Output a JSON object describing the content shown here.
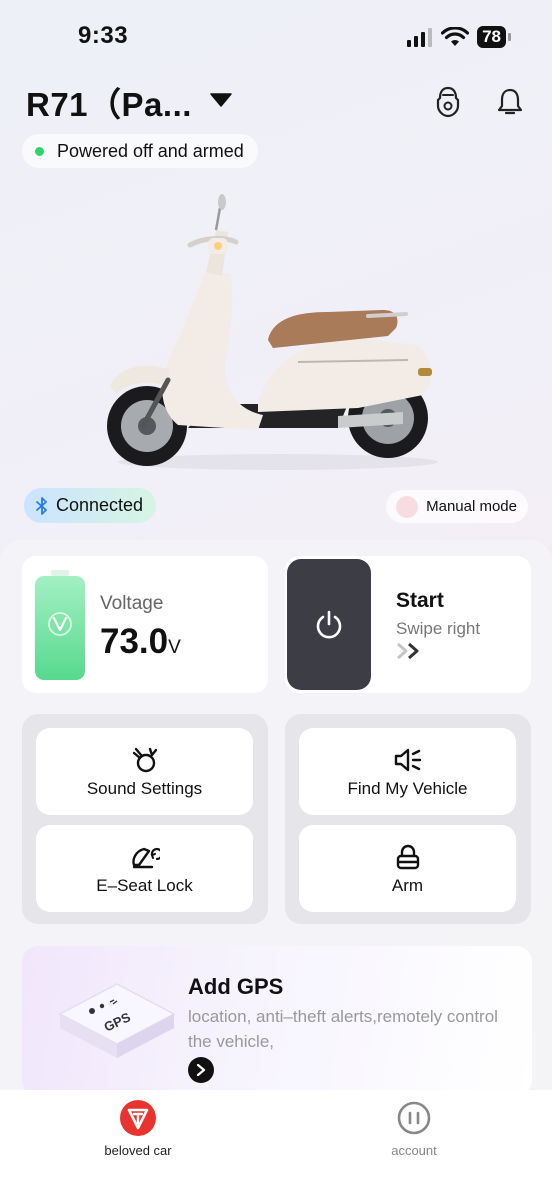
{
  "status_bar": {
    "time": "9:33",
    "battery": "78"
  },
  "header": {
    "vehicle_name": "R71（Pa...",
    "icons": [
      "scooter-outline-icon",
      "bell-icon"
    ]
  },
  "vehicle_status": "Powered off and armed",
  "connection": {
    "label": "Connected",
    "icon": "bluetooth-icon"
  },
  "manual_mode": {
    "label": "Manual mode"
  },
  "voltage": {
    "label": "Voltage",
    "value": "73.0",
    "unit": "V"
  },
  "start": {
    "title": "Start",
    "subtitle": "Swipe right",
    "icon": "power-icon"
  },
  "actions": {
    "sound_settings": {
      "label": "Sound Settings",
      "icon": "sound-icon"
    },
    "find_vehicle": {
      "label": "Find My Vehicle",
      "icon": "speaker-icon"
    },
    "eseat_lock": {
      "label": "E–Seat Lock",
      "icon": "seat-lock-icon"
    },
    "arm": {
      "label": "Arm",
      "icon": "lock-icon"
    }
  },
  "gps_promo": {
    "title": "Add GPS",
    "description": "location, anti–theft alerts,remotely control the vehicle,",
    "graphic_label": "GPS"
  },
  "tabbar": {
    "items": [
      {
        "label": "beloved car",
        "active": true,
        "icon": "brand-logo-icon"
      },
      {
        "label": "account",
        "active": false,
        "icon": "account-icon"
      }
    ]
  },
  "colors": {
    "accent_green": "#2ed46d",
    "brand_red": "#e8332f",
    "dark_knob": "#3d3e45"
  }
}
